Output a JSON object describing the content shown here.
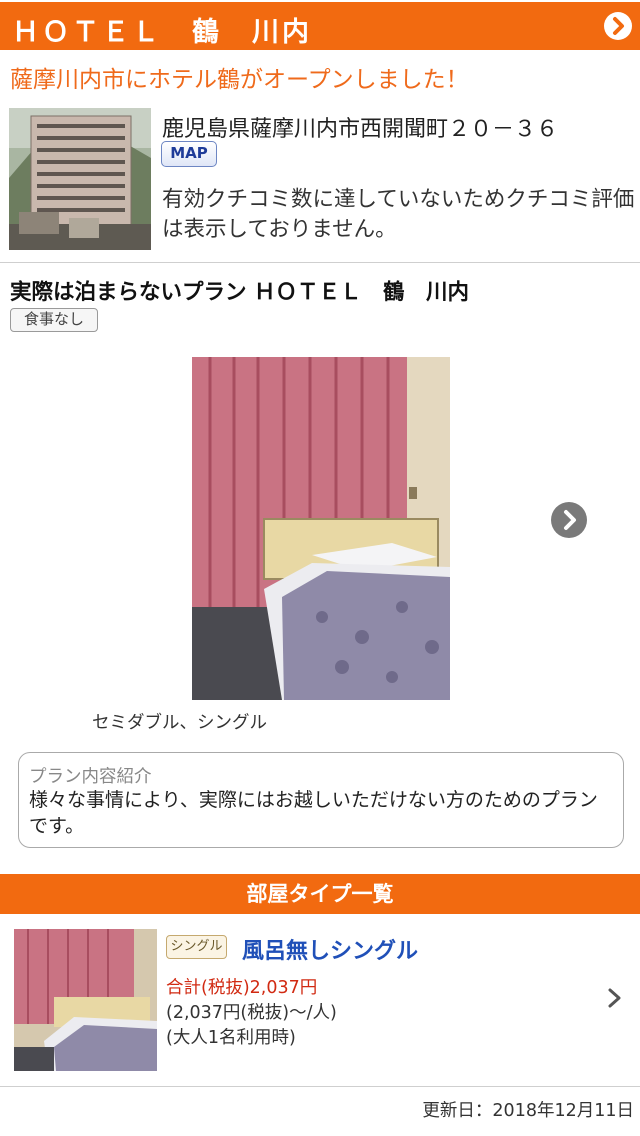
{
  "header": {
    "title": "ＨＯＴＥＬ　鶴　川内",
    "nav_icon": "chevron-right-circle-icon"
  },
  "announcement": "薩摩川内市にホテル鶴がオープンしました！",
  "hotel": {
    "address": "鹿児島県薩摩川内市西開聞町２０－３６",
    "map_label": "MAP",
    "review_note": "有効クチコミ数に達していないためクチコミ評価は表示しておりません。"
  },
  "plan": {
    "title": "実際は泊まらないプラン ＨＯＴＥＬ　鶴　川内",
    "meal_badge": "食事なし",
    "room_caption": "セミダブル、シングル",
    "gallery_next_icon": "chevron-right-circle-icon",
    "details": {
      "heading": "プラン内容紹介",
      "text": "様々な事情により、実際にはお越しいただけない方のためのプランです。"
    }
  },
  "room_types": {
    "section_title": "部屋タイプ一覧",
    "items": [
      {
        "badge": "シングル",
        "name": "風呂無しシングル",
        "total": "合計(税抜)2,037円",
        "unit": "(2,037円(税抜)～/人)",
        "occupancy": "(大人1名利用時)",
        "chevron_icon": "chevron-right-icon"
      }
    ]
  },
  "footer": {
    "updated": "更新日：2018年12月11日"
  },
  "colors": {
    "accent": "#f26a10",
    "link_blue": "#2050b8",
    "price_red": "#d12a12"
  }
}
